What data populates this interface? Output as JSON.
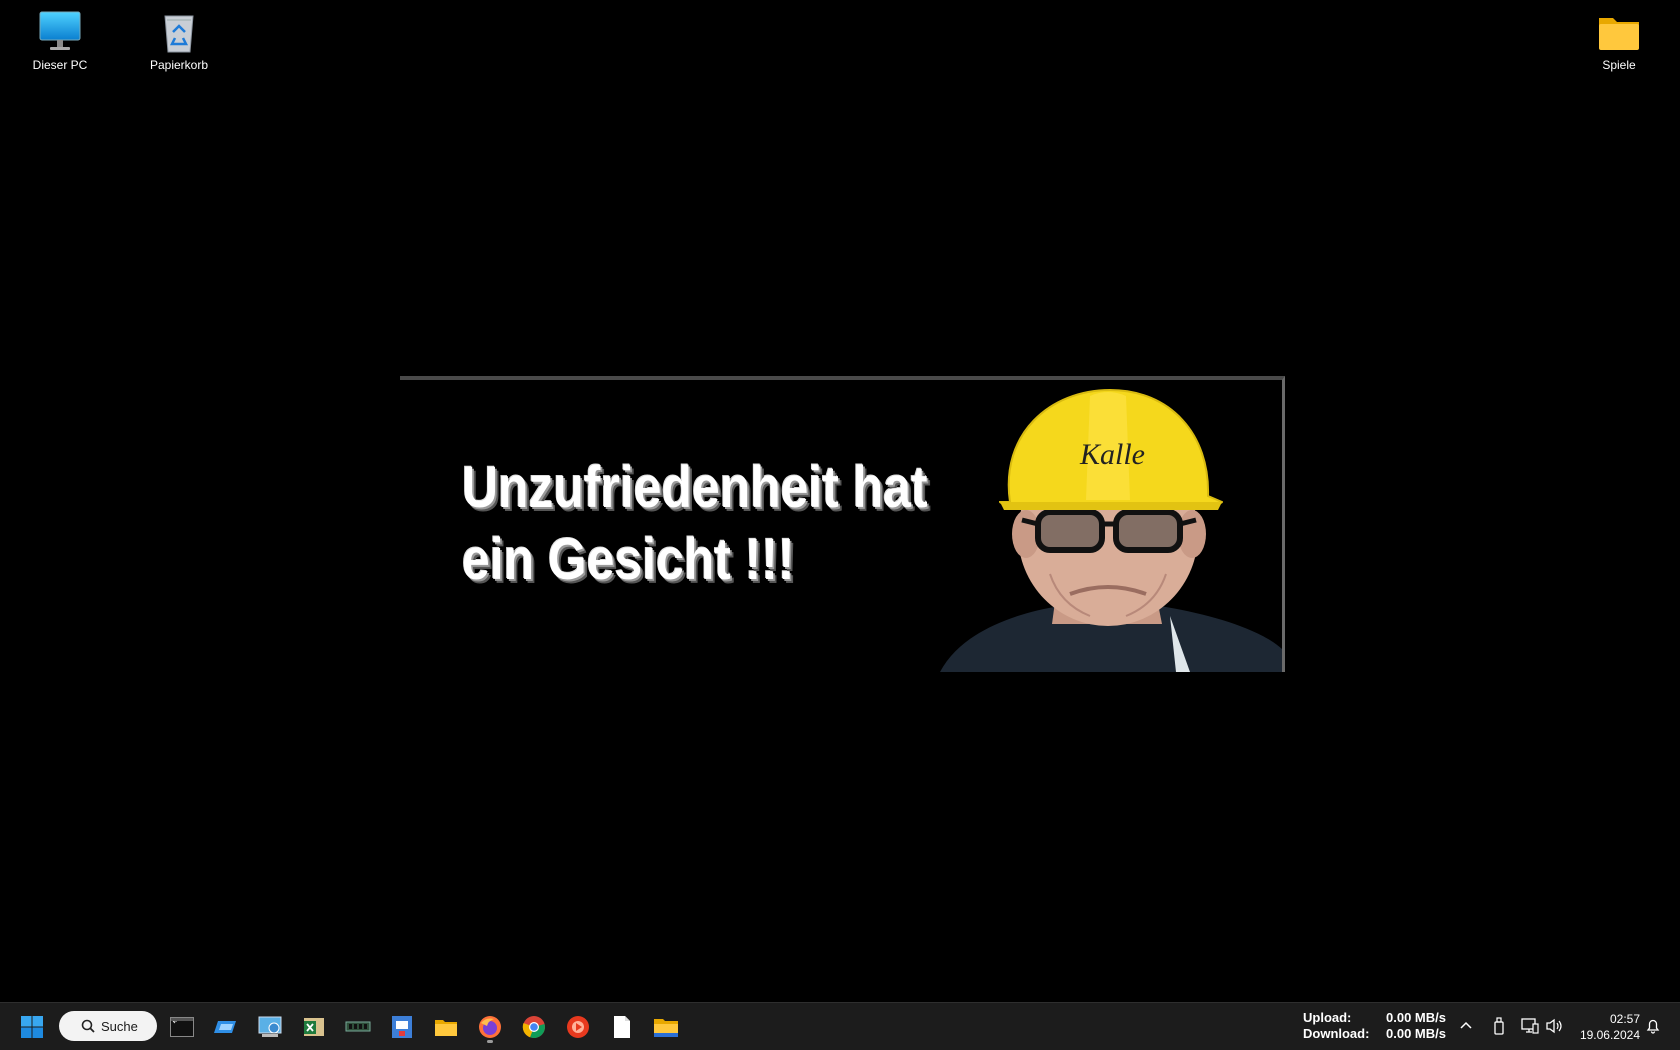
{
  "desktop": {
    "icons": [
      {
        "label": "Dieser PC",
        "icon": "computer-icon"
      },
      {
        "label": "Papierkorb",
        "icon": "recycle-bin-icon"
      },
      {
        "label": "Spiele",
        "icon": "folder-icon"
      }
    ]
  },
  "wallpaper": {
    "line1": "Unzufriedenheit hat",
    "line2": "ein Gesicht !!!",
    "helmet_text": "Kalle",
    "colors": {
      "helmet": "#f5d81c",
      "background": "#000000"
    }
  },
  "taskbar": {
    "start_icon": "windows-start-icon",
    "search_label": "Suche",
    "apps": [
      {
        "name": "terminal-icon",
        "active": false
      },
      {
        "name": "remote-desktop-icon",
        "active": false
      },
      {
        "name": "control-panel-icon",
        "active": false
      },
      {
        "name": "excel-icon",
        "active": false
      },
      {
        "name": "memory-module-icon",
        "active": false
      },
      {
        "name": "id-card-app-icon",
        "active": false
      },
      {
        "name": "file-explorer-icon",
        "active": false
      },
      {
        "name": "firefox-icon",
        "active": true
      },
      {
        "name": "chrome-icon",
        "active": false
      },
      {
        "name": "media-player-icon",
        "active": false
      },
      {
        "name": "blank-document-icon",
        "active": false
      },
      {
        "name": "folder-icon",
        "active": false
      }
    ],
    "network": {
      "upload_label": "Upload:",
      "upload_value": "0.00 MB/s",
      "download_label": "Download:",
      "download_value": "0.00 MB/s"
    },
    "tray_icons": [
      "chevron-up-icon",
      "usb-drive-icon",
      "network-icon",
      "volume-icon"
    ],
    "time": "02:57",
    "date": "19.06.2024",
    "notification_icon": "bell-icon"
  }
}
